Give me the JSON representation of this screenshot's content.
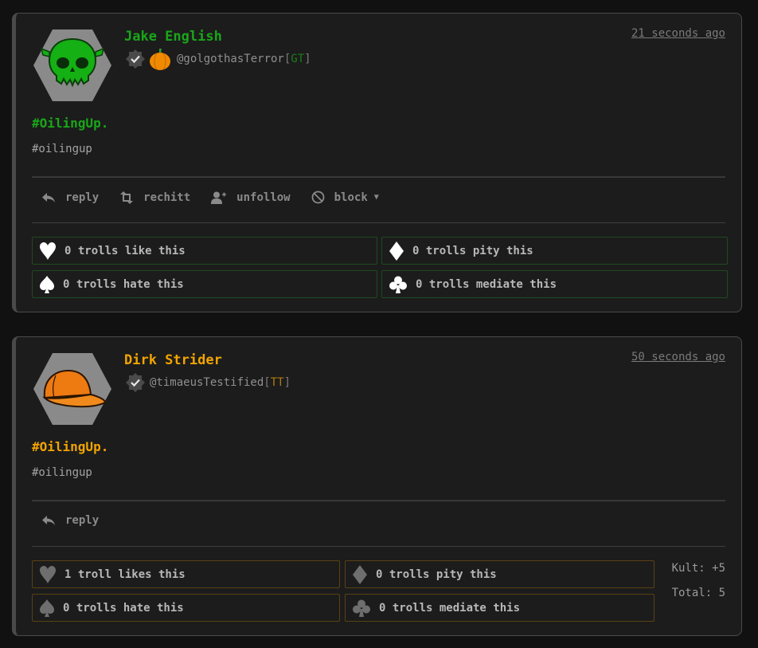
{
  "posts": [
    {
      "author": "Jake English",
      "author_color": "#19a619",
      "time": "21 seconds ago",
      "handle": "@golgothasTerror",
      "tag": "GT",
      "tag_color": "#1a7f1a",
      "badges": [
        "verified-icon",
        "pumpkin-icon"
      ],
      "avatar_icon": "skull-icon",
      "headline": "#OilingUp.",
      "hashtag": "#oilingup",
      "actions": {
        "reply": "reply",
        "rechitt": "rechitt",
        "unfollow": "unfollow",
        "block": "block"
      },
      "votes": {
        "like": "0 trolls like this",
        "pity": "0 trolls pity this",
        "hate": "0 trolls hate this",
        "mediate": "0 trolls mediate this"
      },
      "vote_icon_color": "#ffffff"
    },
    {
      "author": "Dirk Strider",
      "author_color": "#f2a400",
      "time": "50 seconds ago",
      "handle": "@timaeusTestified",
      "tag": "TT",
      "tag_color": "#b07a10",
      "badges": [
        "verified-icon"
      ],
      "avatar_icon": "cap-icon",
      "headline": "#OilingUp.",
      "hashtag": "#oilingup",
      "actions": {
        "reply": "reply"
      },
      "votes": {
        "like": "1 troll likes this",
        "pity": "0 trolls pity this",
        "hate": "0 trolls hate this",
        "mediate": "0 trolls mediate this"
      },
      "vote_icon_color": "#6e6e6e",
      "score": {
        "kult": "Kult: +5",
        "total": "Total: 5"
      }
    }
  ]
}
